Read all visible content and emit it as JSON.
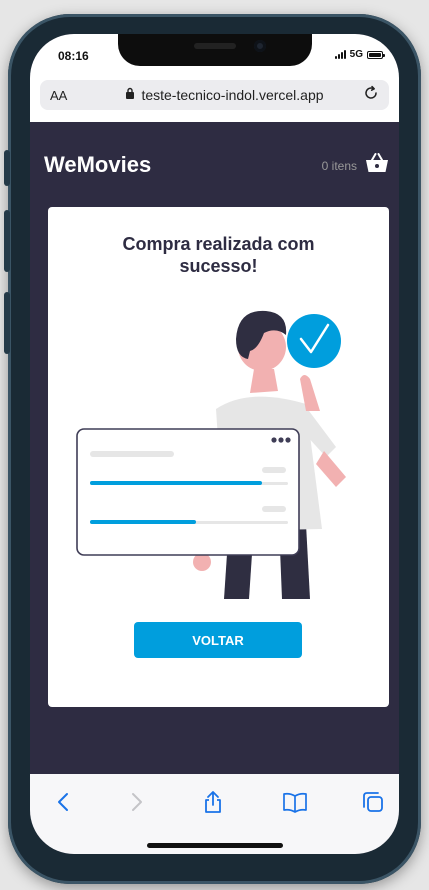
{
  "status": {
    "time": "08:16",
    "network": "5G"
  },
  "browser": {
    "text_size_label": "AA",
    "url": "teste-tecnico-indol.vercel.app"
  },
  "header": {
    "brand": "WeMovies",
    "cart_count": "0 itens"
  },
  "success": {
    "title": "Compra realizada com sucesso!",
    "button_label": "VOLTAR"
  },
  "toolbar": {
    "icons": [
      "back-icon",
      "forward-icon",
      "share-icon",
      "bookmarks-icon",
      "tabs-icon"
    ]
  },
  "colors": {
    "app_background": "#2e2c42",
    "accent": "#009edd",
    "card": "#ffffff"
  }
}
